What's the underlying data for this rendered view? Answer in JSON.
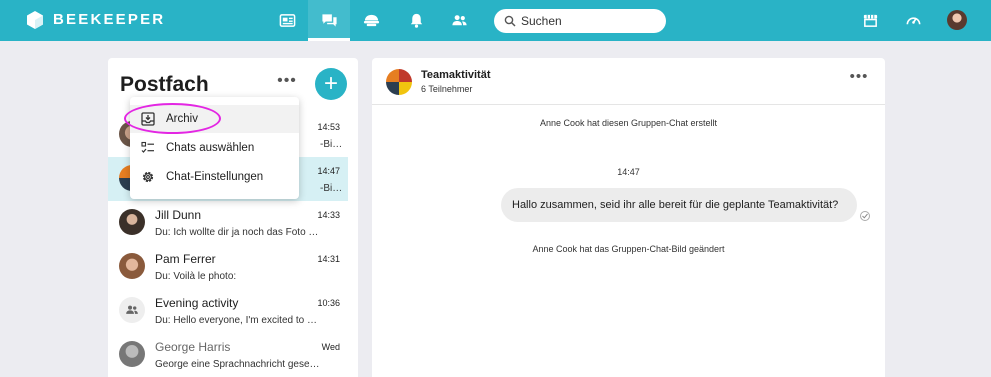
{
  "topbar": {
    "brand": "BEEKEEPER",
    "search": {
      "placeholder": "Suchen",
      "value": ""
    },
    "nav": [
      "news-icon",
      "chat-icon",
      "hat-icon",
      "bell-icon",
      "people-icon"
    ],
    "right": [
      "shop-icon",
      "speedometer-icon",
      "avatar"
    ],
    "colors": {
      "bar": "#29b3c6",
      "active_indicator": "#ffffff"
    }
  },
  "inbox": {
    "title": "Postfach",
    "more_label": "•••",
    "add_label": "+",
    "chats": [
      {
        "name": "",
        "preview": "-Bi…",
        "time": "14:53"
      },
      {
        "name": "",
        "preview": "-Bi…",
        "time": "14:47",
        "selected": true
      },
      {
        "name": "Jill Dunn",
        "preview": "Du: Ich wollte dir ja noch das Foto s…",
        "time": "14:33"
      },
      {
        "name": "Pam Ferrer",
        "preview": "Du: Voilà le photo:",
        "time": "14:31"
      },
      {
        "name": "Evening activity",
        "preview": "Du: Hello everyone, I'm excited to a…",
        "time": "10:36"
      },
      {
        "name": "George Harris",
        "preview": "George eine Sprachnachricht gesen…",
        "time": "Wed"
      }
    ]
  },
  "menu": {
    "items": [
      {
        "label": "Archiv",
        "icon": "archive-icon"
      },
      {
        "label": "Chats auswählen",
        "icon": "checklist-icon"
      },
      {
        "label": "Chat-Einstellungen",
        "icon": "gear-icon"
      }
    ]
  },
  "chat": {
    "name": "Teamaktivität",
    "participants": "6 Teilnehmer",
    "more_label": "•••",
    "messages": {
      "created": "Anne Cook hat diesen Gruppen-Chat erstellt",
      "time": "14:47",
      "bubble": "Hallo zusammen, seid ihr alle bereit für die geplante Teamaktivität?",
      "image_changed": "Anne Cook hat das Gruppen-Chat-Bild geändert"
    }
  }
}
